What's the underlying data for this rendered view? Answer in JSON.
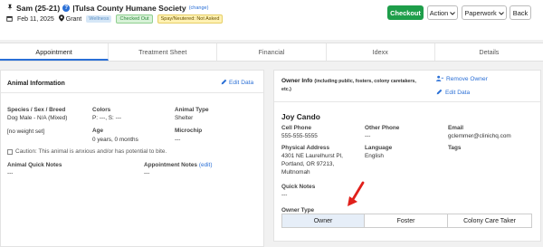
{
  "header": {
    "animal_name": "Sam (25-21)",
    "separator": "| ",
    "org": "Tulsa County Humane Society",
    "change_link": "(change)",
    "date": "Feb 11, 2025",
    "location": "Grant",
    "badges": {
      "wellness": "Wellness",
      "checked": "Checked Out",
      "spay": "Spay/Neutered: Not Asked"
    },
    "buttons": {
      "checkout": "Checkout",
      "action": "Action",
      "paperwork": "Paperwork",
      "back": "Back"
    }
  },
  "tabs": [
    "Appointment",
    "Treatment Sheet",
    "Financial",
    "Idexx",
    "Details"
  ],
  "animal": {
    "title": "Animal Information",
    "edit": "Edit Data",
    "species_label": "Species / Sex / Breed",
    "species_value": "Dog Male - N/A (Mixed)",
    "weight": "[no weight set]",
    "colors_label": "Colors",
    "colors_value": "P: ---, S: ---",
    "age_label": "Age",
    "age_value": "0 years, 0 months",
    "type_label": "Animal Type",
    "type_value": "Shelter",
    "microchip_label": "Microchip",
    "microchip_value": "---",
    "caution": "Caution: This animal is anxious and/or has potential to bite.",
    "quick_notes_label": "Animal Quick Notes",
    "quick_notes_value": "---",
    "appt_notes_label": "Appointment Notes",
    "appt_notes_edit": "(edit)",
    "appt_notes_value": "---"
  },
  "owner": {
    "title": "Owner Info",
    "subtitle": "(including public, fosters, colony caretakers,",
    "subtitle2": "etc.)",
    "remove": "Remove Owner",
    "edit": "Edit Data",
    "name": "Joy Cando",
    "cell_label": "Cell Phone",
    "cell_value": "555-555-5555",
    "other_label": "Other Phone",
    "other_value": "---",
    "email_label": "Email",
    "email_value": "gclemmer@clinichq.com",
    "address_label": "Physical Address",
    "address_lines": [
      "4301 NE Laurelhurst Pl,",
      "Portland, OR 97213,",
      "Multnomah"
    ],
    "language_label": "Language",
    "language_value": "English",
    "tags_label": "Tags",
    "quick_label": "Quick Notes",
    "quick_value": "---",
    "type_label": "Owner Type",
    "types": [
      "Owner",
      "Foster",
      "Colony Care Taker"
    ]
  },
  "colors": {
    "accent": "#2a6fd6",
    "success": "#1e9e4a",
    "arrow": "#e0201b"
  }
}
